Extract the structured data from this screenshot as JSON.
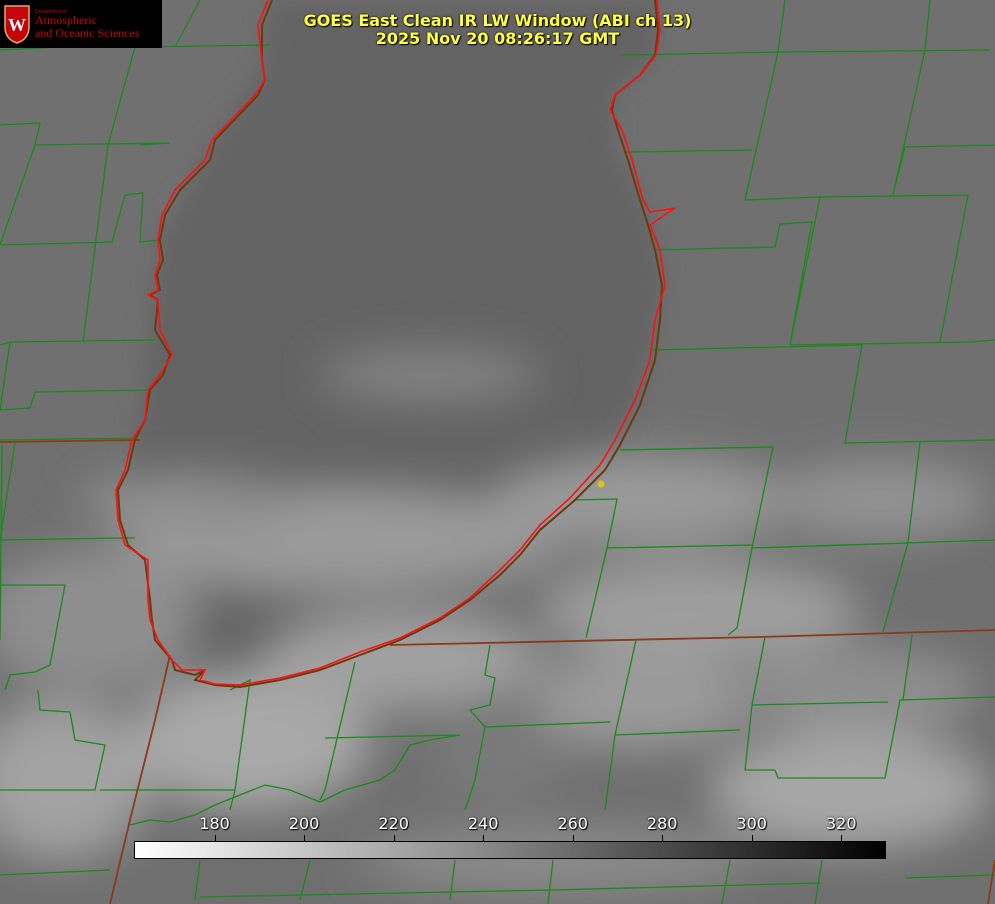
{
  "title": {
    "line1": "GOES East Clean IR LW Window (ABI ch 13)",
    "line2": "2025 Nov 20 08:26:17 GMT"
  },
  "logo": {
    "department": "Department of",
    "line1": "Atmospheric",
    "line2": "and Oceanic Sciences",
    "crest_letter": "W"
  },
  "colorbar": {
    "min": 162,
    "max": 330,
    "ticks": [
      "180",
      "200",
      "220",
      "240",
      "260",
      "280",
      "300",
      "320"
    ],
    "tick_values": [
      180,
      200,
      220,
      240,
      260,
      280,
      300,
      320
    ],
    "low_color": "#ffffff",
    "high_color": "#000000"
  },
  "colors": {
    "county_lines": "#1a8a1a",
    "coastline": "#ff1010",
    "state_lines": "#8b3a1a",
    "title_text": "#ffff44",
    "marker": "#d9c21a"
  },
  "icons": {
    "logo_crest": "uw-crest-icon",
    "station_marker": "station-dot-icon"
  }
}
